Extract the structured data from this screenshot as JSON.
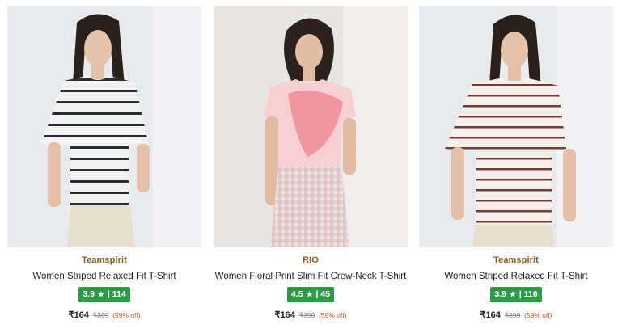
{
  "currency_symbol": "₹",
  "star_icon": "★",
  "colors": {
    "brand_text": "#8b5a1e",
    "rating_badge": "#2e9b46",
    "discount_text": "#c85a1a"
  },
  "products": [
    {
      "brand": "Teamspirit",
      "name": "Women Striped Relaxed Fit T-Shirt",
      "rating": "3.9",
      "reviews": "114",
      "price": "164",
      "mrp": "399",
      "discount": "(59% off)",
      "image": "woman-striped-white-black-tshirt-photo"
    },
    {
      "brand": "RIO",
      "name": "Women Floral Print Slim Fit Crew-Neck T-Shirt",
      "rating": "4.5",
      "reviews": "45",
      "price": "164",
      "mrp": "399",
      "discount": "(59% off)",
      "image": "woman-pink-floral-tshirt-photo"
    },
    {
      "brand": "Teamspirit",
      "name": "Women Striped Relaxed Fit T-Shirt",
      "rating": "3.9",
      "reviews": "116",
      "price": "164",
      "mrp": "399",
      "discount": "(59% off)",
      "image": "woman-striped-white-brown-tshirt-photo"
    }
  ]
}
